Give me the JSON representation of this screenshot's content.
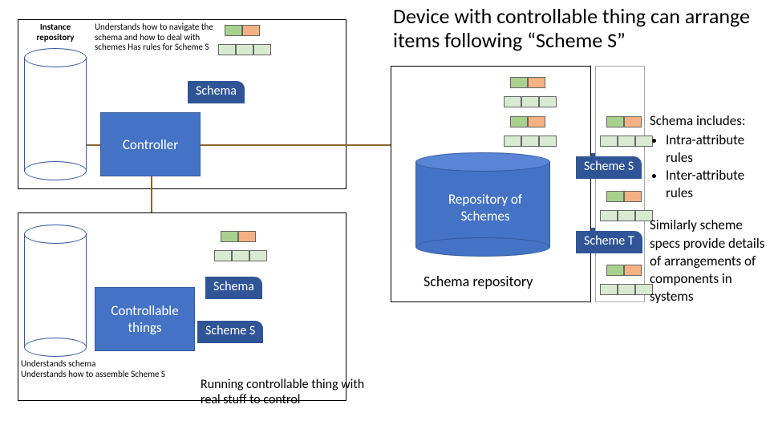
{
  "title": "Device with controllable thing can arrange items following “Scheme S”",
  "topLeft": {
    "label": "Instance repository",
    "note": "Understands how to navigate the schema and how to deal with schemes  Has rules for Scheme S",
    "tab": "Schema",
    "controller": "Controller"
  },
  "bottomLeft": {
    "tab1": "Schema",
    "tab2": "Scheme S",
    "controller": "Controllable things",
    "noteLine1": "Understands schema",
    "noteLine2": "Understands how to assemble Scheme S",
    "caption": "Running controllable thing with real stuff to control"
  },
  "middle": {
    "repoLabel": "Repository of Schemes",
    "repoCaption": "Schema repository",
    "tabS": "Scheme S",
    "tabT": "Scheme T"
  },
  "rightText": {
    "heading": "Schema includes:",
    "bullet1": "Intra-attribute rules",
    "bullet2": "Inter-attribute rules",
    "para": "Similarly scheme specs provide details of arrangements of components in systems"
  }
}
